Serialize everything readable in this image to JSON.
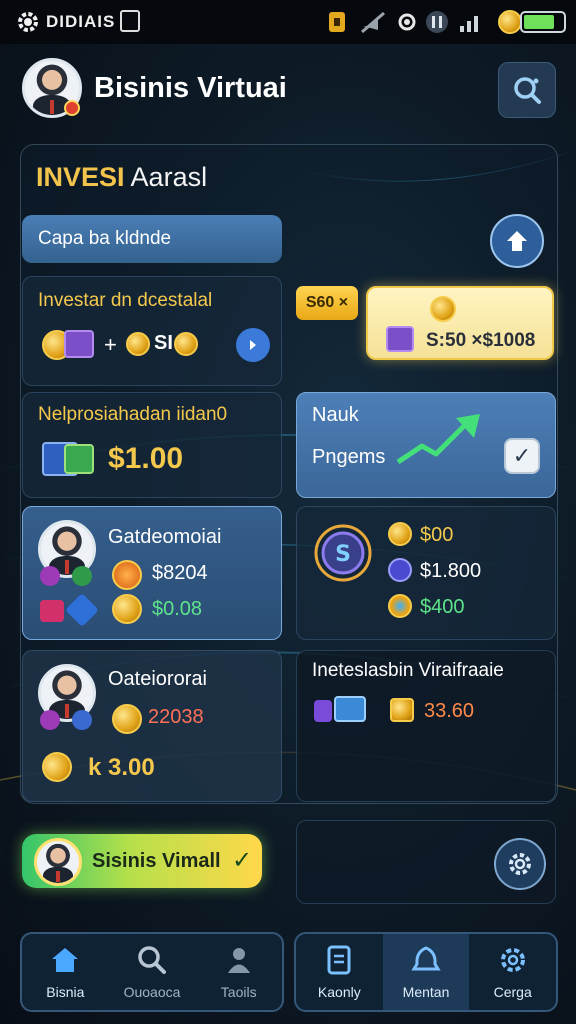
{
  "status_bar": {
    "text": "DIDIAIS"
  },
  "header": {
    "title": "Bisinis Virtuai"
  },
  "invest_panel": {
    "title_highlight": "INVESI",
    "title_rest": "Aarasl",
    "pill_label": "Capa ba kldnde"
  },
  "cards": {
    "investar": {
      "title": "Investar dn dcestalal",
      "plus": "+",
      "amount": "SI",
      "tag": "S60 ×",
      "offer": "S:50 ×$1008"
    },
    "nelpro": {
      "title": "Nelprosiahadan iidan0",
      "amount": "$1.00"
    },
    "nauk": {
      "line1": "Nauk",
      "line2": "Pngems",
      "check": "✓"
    },
    "gated1": {
      "title": "Gatdeomoiai",
      "value1": "$8204",
      "value2": "$0.08"
    },
    "coins": {
      "value1": "$00",
      "value2": "$1.800",
      "value3": "$400"
    },
    "gated2": {
      "title": "Oateiororai",
      "value1": "22038",
      "value2": "k 3.00"
    },
    "ineteslasbin": {
      "title": "Ineteslasbin Viraifraaie",
      "value": "33.60"
    }
  },
  "virtual_button": {
    "label": "Sisinis Vimall",
    "check": "✓"
  },
  "bottom_nav": {
    "left": [
      {
        "label": "Bisnia",
        "icon": "home-icon"
      },
      {
        "label": "Ouoaoca",
        "icon": "search-icon"
      },
      {
        "label": "Taoils",
        "icon": "user-icon"
      }
    ],
    "right": [
      {
        "label": "Kaonly",
        "icon": "document-icon"
      },
      {
        "label": "Mentan",
        "icon": "bell-icon"
      },
      {
        "label": "Cerga",
        "icon": "gear-icon"
      }
    ]
  },
  "colors": {
    "accent_gold": "#f4c84c",
    "accent_green": "#5ee38a",
    "accent_red": "#ff7059",
    "panel_blue": "#4d7fb8"
  }
}
